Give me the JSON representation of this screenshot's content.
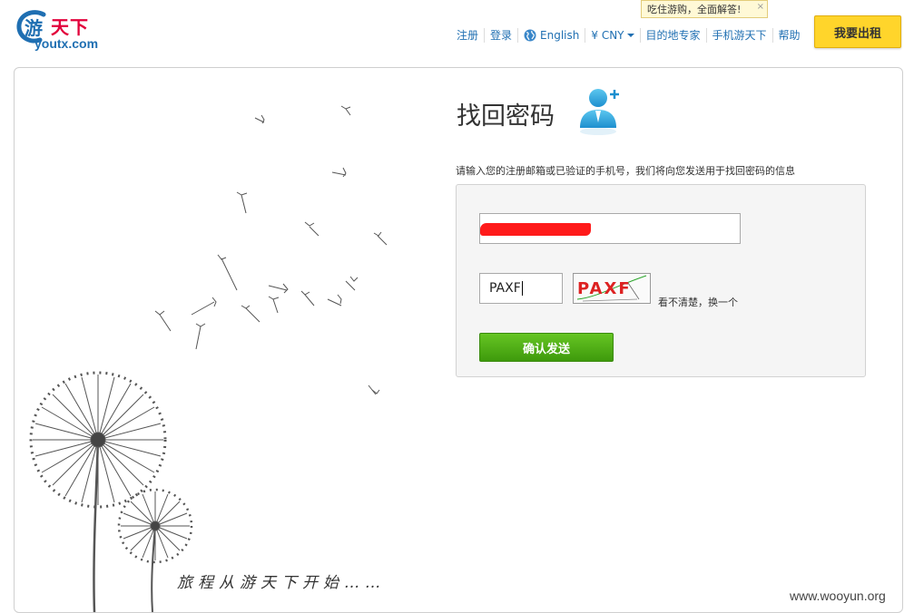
{
  "header": {
    "logo_cn": "天下",
    "logo_en": "youtx.com",
    "nav": [
      {
        "label": "注册"
      },
      {
        "label": "登录"
      },
      {
        "label": "English"
      },
      {
        "label": "¥ CNY"
      },
      {
        "label": "目的地专家"
      },
      {
        "label": "手机游天下"
      },
      {
        "label": "帮助"
      }
    ],
    "tooltip": "吃住游购，全面解答!",
    "tooltip_close": "×",
    "rent_button": "我要出租"
  },
  "art": {
    "slogan": "旅程从游天下开始……"
  },
  "form": {
    "title": "找回密码",
    "instruction": "请输入您的注册邮箱或已验证的手机号，我们将向您发送用于找回密码的信息",
    "email_value": "",
    "captcha_value": "PAXF",
    "captcha_image_text": "PAXF",
    "refresh_label": "看不清楚，换一个",
    "submit_label": "确认发送"
  },
  "watermark": "www.wooyun.org",
  "colors": {
    "brand_red": "#e2003b",
    "link_blue": "#1f6fb2",
    "rent_yellow": "#ffd52b",
    "submit_green": "#4fae14",
    "redaction": "#ff1a1a"
  }
}
